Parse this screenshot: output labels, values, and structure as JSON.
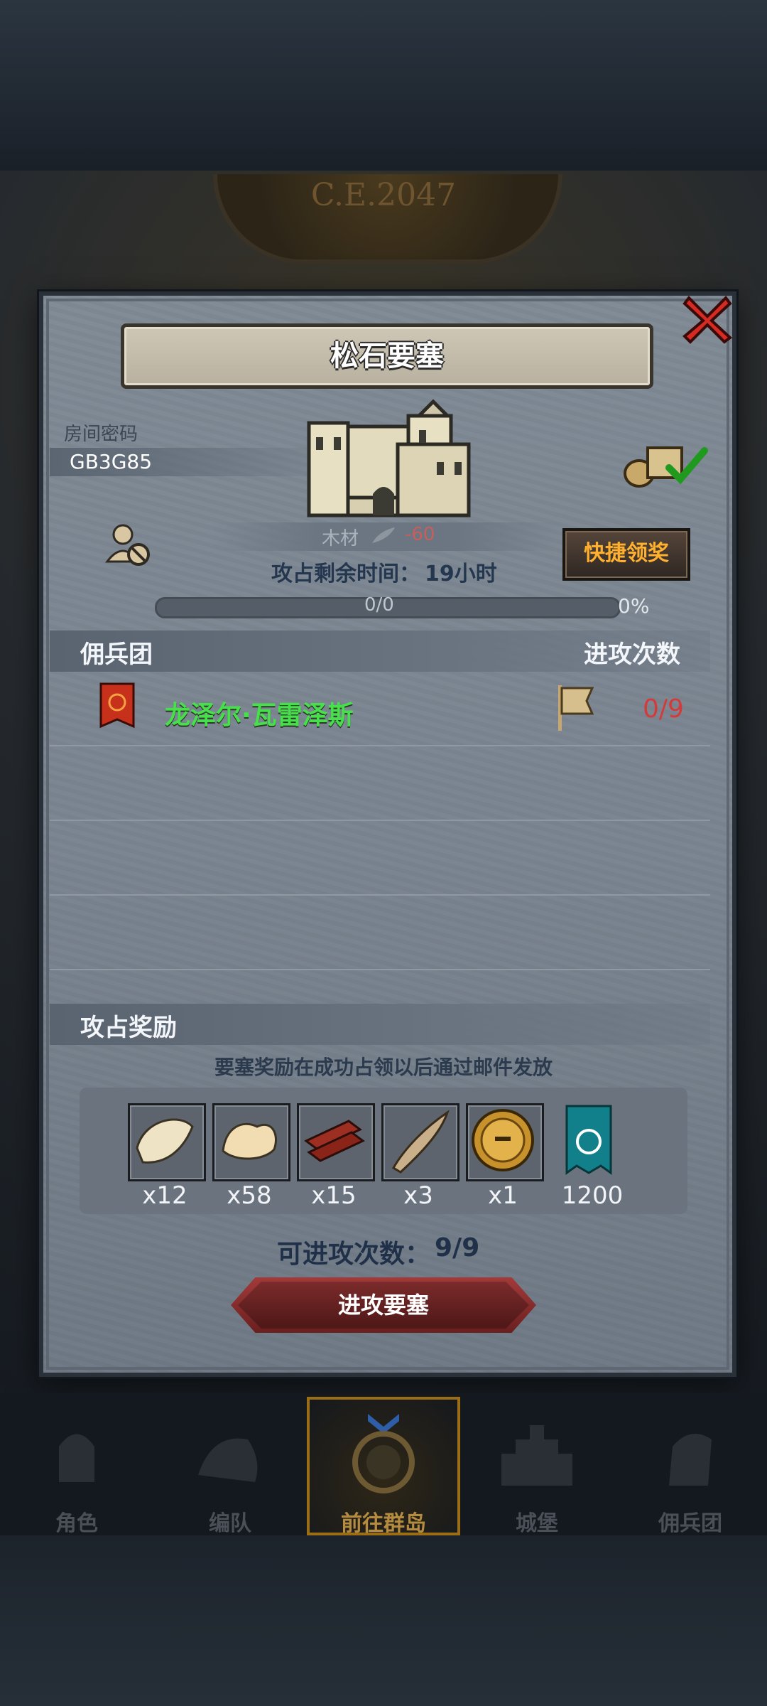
{
  "header": {
    "era": "C.E.2047"
  },
  "modal": {
    "title": "松石要塞",
    "room_label": "房间密码",
    "room_code": "GB3G85",
    "resource_name": "木材",
    "resource_delta": "-60",
    "quick_claim": "快捷领奖",
    "time_label": "攻占剩余时间：",
    "time_value": "19小时",
    "progress_text": "0/0",
    "progress_percent": "0%",
    "progress_fraction": 0
  },
  "mercenary": {
    "header_left": "佣兵团",
    "header_right": "进攻次数",
    "rows": [
      {
        "name": "龙泽尔·瓦雷泽斯",
        "attacks": "0/9"
      }
    ]
  },
  "rewards": {
    "header": "攻占奖励",
    "note": "要塞奖励在成功占领以后通过邮件发放",
    "items": [
      {
        "icon": "fur-pelt-icon",
        "count": "x12"
      },
      {
        "icon": "wool-icon",
        "count": "x58"
      },
      {
        "icon": "wood-planks-icon",
        "count": "x15"
      },
      {
        "icon": "horn-icon",
        "count": "x3"
      },
      {
        "icon": "gold-helmet-medal-icon",
        "count": "x1"
      },
      {
        "icon": "teal-banner-icon",
        "count": "1200"
      }
    ]
  },
  "attack": {
    "count_label": "可进攻次数：",
    "count_value": "9/9",
    "button_label": "进攻要塞"
  },
  "nav": {
    "items": [
      {
        "label": "角色",
        "active": false
      },
      {
        "label": "编队",
        "active": false
      },
      {
        "label": "前往群岛",
        "active": true
      },
      {
        "label": "城堡",
        "active": false
      },
      {
        "label": "佣兵团",
        "active": false
      }
    ]
  },
  "colors": {
    "merc_name": "#45e04a",
    "attack_count_red": "#d33b3b",
    "quick_claim_text": "#ffb02e",
    "nav_active": "#b58c3f"
  }
}
